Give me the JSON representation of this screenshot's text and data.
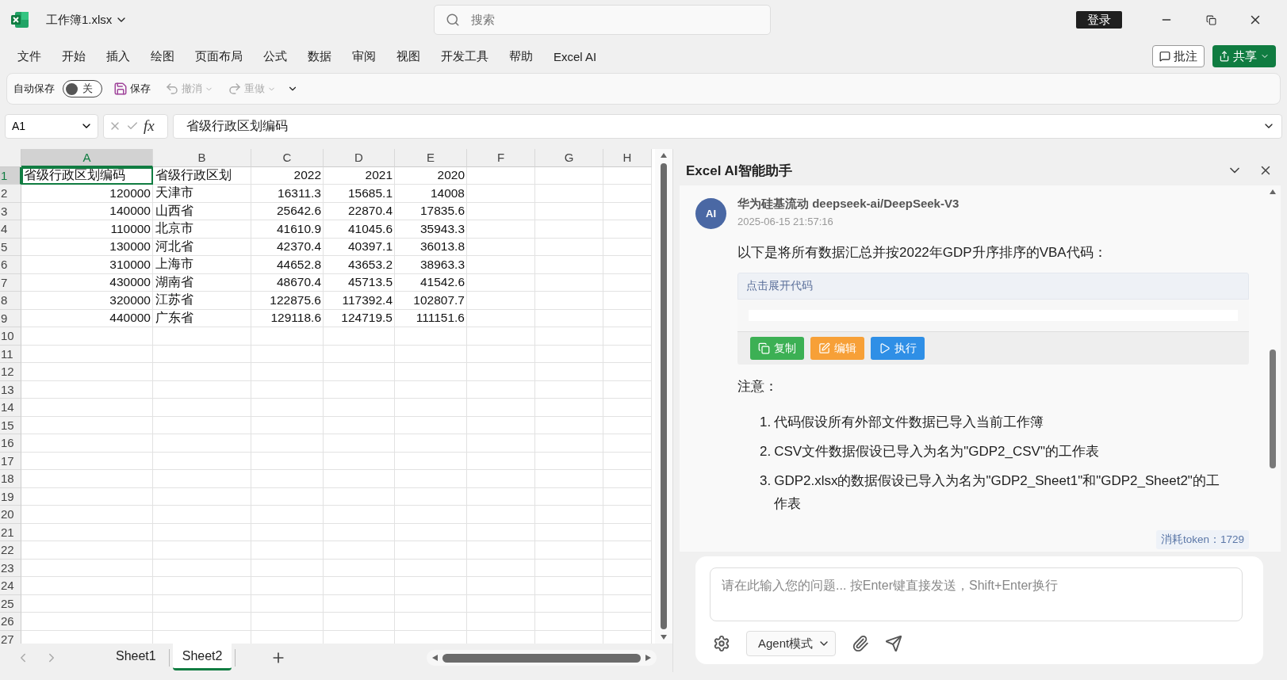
{
  "title_bar": {
    "file_name": "工作簿1.xlsx",
    "search": {
      "placeholder": "搜索"
    },
    "login": "登录"
  },
  "menu": {
    "items": [
      "文件",
      "开始",
      "插入",
      "绘图",
      "页面布局",
      "公式",
      "数据",
      "审阅",
      "视图",
      "开发工具",
      "帮助",
      "Excel AI"
    ],
    "comment_button": "批注",
    "share_button": "共享"
  },
  "quick_access": {
    "autosave_label": "自动保存",
    "autosave": {
      "on": false,
      "label": "关"
    },
    "save": "保存",
    "undo": {
      "label": "撤消",
      "disabled": true
    },
    "redo": {
      "label": "重做",
      "disabled": true
    }
  },
  "formula_bar": {
    "name_box": "A1",
    "fx": "fx",
    "value": "省级行政区划编码"
  },
  "sheet": {
    "columns": [
      {
        "label": "A",
        "selected": true
      },
      {
        "label": "B",
        "selected": false
      },
      {
        "label": "C",
        "selected": false
      },
      {
        "label": "D",
        "selected": false
      },
      {
        "label": "E",
        "selected": false
      },
      {
        "label": "F",
        "selected": false
      },
      {
        "label": "G",
        "selected": false
      },
      {
        "label": "H",
        "selected": false
      }
    ],
    "rows": [
      {
        "number": "1",
        "selected": true,
        "cells": [
          {
            "text": "省级行政区划编码",
            "kind": "text"
          },
          {
            "text": "省级行政区划",
            "kind": "text"
          },
          {
            "text": "2022",
            "kind": "number"
          },
          {
            "text": "2021",
            "kind": "number"
          },
          {
            "text": "2020",
            "kind": "number"
          }
        ]
      },
      {
        "number": "2",
        "selected": false,
        "cells": [
          {
            "text": "120000",
            "kind": "number"
          },
          {
            "text": "天津市",
            "kind": "text"
          },
          {
            "text": "16311.3",
            "kind": "number"
          },
          {
            "text": "15685.1",
            "kind": "number"
          },
          {
            "text": "14008",
            "kind": "number"
          }
        ]
      },
      {
        "number": "3",
        "selected": false,
        "cells": [
          {
            "text": "140000",
            "kind": "number"
          },
          {
            "text": "山西省",
            "kind": "text"
          },
          {
            "text": "25642.6",
            "kind": "number"
          },
          {
            "text": "22870.4",
            "kind": "number"
          },
          {
            "text": "17835.6",
            "kind": "number"
          }
        ]
      },
      {
        "number": "4",
        "selected": false,
        "cells": [
          {
            "text": "110000",
            "kind": "number"
          },
          {
            "text": "北京市",
            "kind": "text"
          },
          {
            "text": "41610.9",
            "kind": "number"
          },
          {
            "text": "41045.6",
            "kind": "number"
          },
          {
            "text": "35943.3",
            "kind": "number"
          }
        ]
      },
      {
        "number": "5",
        "selected": false,
        "cells": [
          {
            "text": "130000",
            "kind": "number"
          },
          {
            "text": "河北省",
            "kind": "text"
          },
          {
            "text": "42370.4",
            "kind": "number"
          },
          {
            "text": "40397.1",
            "kind": "number"
          },
          {
            "text": "36013.8",
            "kind": "number"
          }
        ]
      },
      {
        "number": "6",
        "selected": false,
        "cells": [
          {
            "text": "310000",
            "kind": "number"
          },
          {
            "text": "上海市",
            "kind": "text"
          },
          {
            "text": "44652.8",
            "kind": "number"
          },
          {
            "text": "43653.2",
            "kind": "number"
          },
          {
            "text": "38963.3",
            "kind": "number"
          }
        ]
      },
      {
        "number": "7",
        "selected": false,
        "cells": [
          {
            "text": "430000",
            "kind": "number"
          },
          {
            "text": "湖南省",
            "kind": "text"
          },
          {
            "text": "48670.4",
            "kind": "number"
          },
          {
            "text": "45713.5",
            "kind": "number"
          },
          {
            "text": "41542.6",
            "kind": "number"
          }
        ]
      },
      {
        "number": "8",
        "selected": false,
        "cells": [
          {
            "text": "320000",
            "kind": "number"
          },
          {
            "text": "江苏省",
            "kind": "text"
          },
          {
            "text": "122875.6",
            "kind": "number"
          },
          {
            "text": "117392.4",
            "kind": "number"
          },
          {
            "text": "102807.7",
            "kind": "number"
          }
        ]
      },
      {
        "number": "9",
        "selected": false,
        "cells": [
          {
            "text": "440000",
            "kind": "number"
          },
          {
            "text": "广东省",
            "kind": "text"
          },
          {
            "text": "129118.6",
            "kind": "number"
          },
          {
            "text": "124719.5",
            "kind": "number"
          },
          {
            "text": "111151.6",
            "kind": "number"
          }
        ]
      },
      {
        "number": "10",
        "selected": false
      },
      {
        "number": "11",
        "selected": false
      },
      {
        "number": "12",
        "selected": false
      },
      {
        "number": "13",
        "selected": false
      },
      {
        "number": "14",
        "selected": false
      },
      {
        "number": "15",
        "selected": false
      },
      {
        "number": "16",
        "selected": false
      },
      {
        "number": "17",
        "selected": false
      },
      {
        "number": "18",
        "selected": false
      },
      {
        "number": "19",
        "selected": false
      },
      {
        "number": "20",
        "selected": false
      },
      {
        "number": "21",
        "selected": false
      },
      {
        "number": "22",
        "selected": false
      },
      {
        "number": "23",
        "selected": false
      },
      {
        "number": "24",
        "selected": false
      },
      {
        "number": "25",
        "selected": false
      },
      {
        "number": "26",
        "selected": false
      },
      {
        "number": "27",
        "selected": false
      }
    ],
    "tabs": [
      {
        "label": "Sheet1",
        "selected": false
      },
      {
        "label": "Sheet2",
        "selected": true
      }
    ]
  },
  "assistant": {
    "title": "Excel AI智能助手",
    "message": {
      "avatar": "AI",
      "sender": "华为硅基流动 deepseek-ai/DeepSeek-V3",
      "time": "2025-06-15 21:57:16",
      "text": "以下是将所有数据汇总并按2022年GDP升序排序的VBA代码：",
      "code_block": {
        "toggle": "点击展开代码",
        "actions": [
          {
            "label": "复制",
            "kind": "copy",
            "color": "#3cb054"
          },
          {
            "label": "编辑",
            "kind": "edit",
            "color": "#f7a037"
          },
          {
            "label": "执行",
            "kind": "run",
            "color": "#2f8fe6"
          }
        ]
      },
      "notes_title": "注意：",
      "notes": [
        {
          "number": "1.",
          "text": "代码假设所有外部文件数据已导入当前工作簿"
        },
        {
          "number": "2.",
          "text": "CSV文件数据假设已导入为名为\"GDP2_CSV\"的工作表"
        },
        {
          "number": "3.",
          "text": "GDP2.xlsx的数据假设已导入为名为\"GDP2_Sheet1\"和\"GDP2_Sheet2\"的工作表"
        }
      ],
      "tokens": "消耗token：1729"
    },
    "input": {
      "placeholder": "请在此输入您的问题... 按Enter键直接发送，Shift+Enter换行",
      "mode": "Agent模式"
    }
  }
}
